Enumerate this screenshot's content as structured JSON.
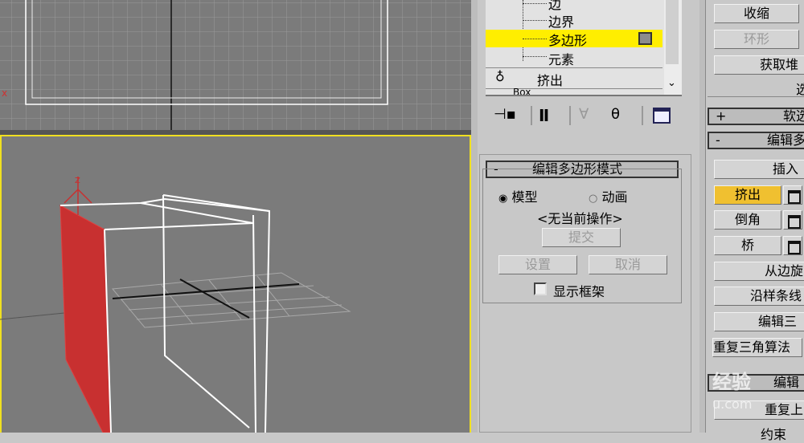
{
  "stack": {
    "items": [
      {
        "label": "边"
      },
      {
        "label": "边界"
      },
      {
        "label": "多边形"
      },
      {
        "label": "元素"
      }
    ],
    "modifier": "挤出",
    "partial": "Box"
  },
  "edit_mode": {
    "title": "编辑多边形模式",
    "radio_model": "模型",
    "radio_anim": "动画",
    "status": "<无当前操作>",
    "commit": "提交",
    "settings": "设置",
    "cancel": "取消",
    "show_cage": "显示框架"
  },
  "right": {
    "shrink": "收缩",
    "ring": "环形",
    "get_stack": "获取堆",
    "partial": "选",
    "soft_sel": "软选",
    "edit_poly": "编辑多",
    "insert_vertex": "插入",
    "extrude": "挤出",
    "bevel": "倒角",
    "bridge": "桥",
    "from_edge": "从边旋",
    "along_spline": "沿样条线",
    "edit_tri": "编辑三",
    "retri": "重复三角算法",
    "edit_geo": "编辑",
    "repeat_last": "重复上",
    "constraint": "约束"
  },
  "watermark": "经验 u.com",
  "colors": {
    "highlight": "#ffee00",
    "active_btn": "#f0c030",
    "selected_face": "#c83030"
  }
}
